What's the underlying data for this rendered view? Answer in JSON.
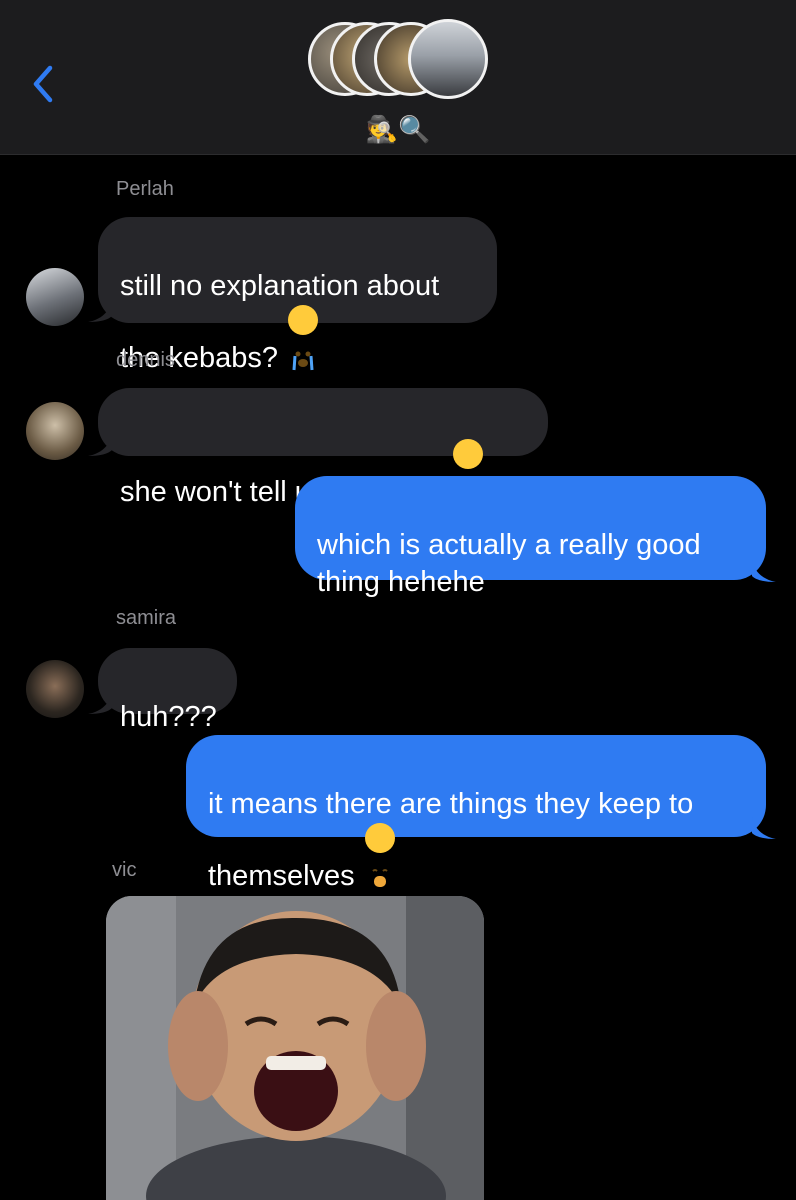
{
  "header": {
    "group_name": "🕵️🔍",
    "back_icon": "chevron-left-icon",
    "accent": "#2f7bf2"
  },
  "messages": [
    {
      "sender": "Perlah",
      "text": "still no explanation about\nthe kebabs?",
      "emoji": "crying-face-icon"
    },
    {
      "sender": "dennis",
      "text": "she won't tell us anything",
      "emoji": "crying-face-icon"
    },
    {
      "sender": "",
      "text": "which is actually a really good\nthing hehehe",
      "emoji": ""
    },
    {
      "sender": "samira",
      "text": "huh???",
      "emoji": ""
    },
    {
      "sender": "",
      "text": "it means there are things they keep to\nthemselves",
      "emoji": "hand-over-mouth-icon"
    },
    {
      "sender": "vic",
      "text": "",
      "emoji": ""
    }
  ],
  "colors": {
    "incoming_bubble": "#26262a",
    "outgoing_bubble": "#2f7bf2",
    "header_bg": "#1c1c1e",
    "sender_label": "#8e8e93"
  }
}
